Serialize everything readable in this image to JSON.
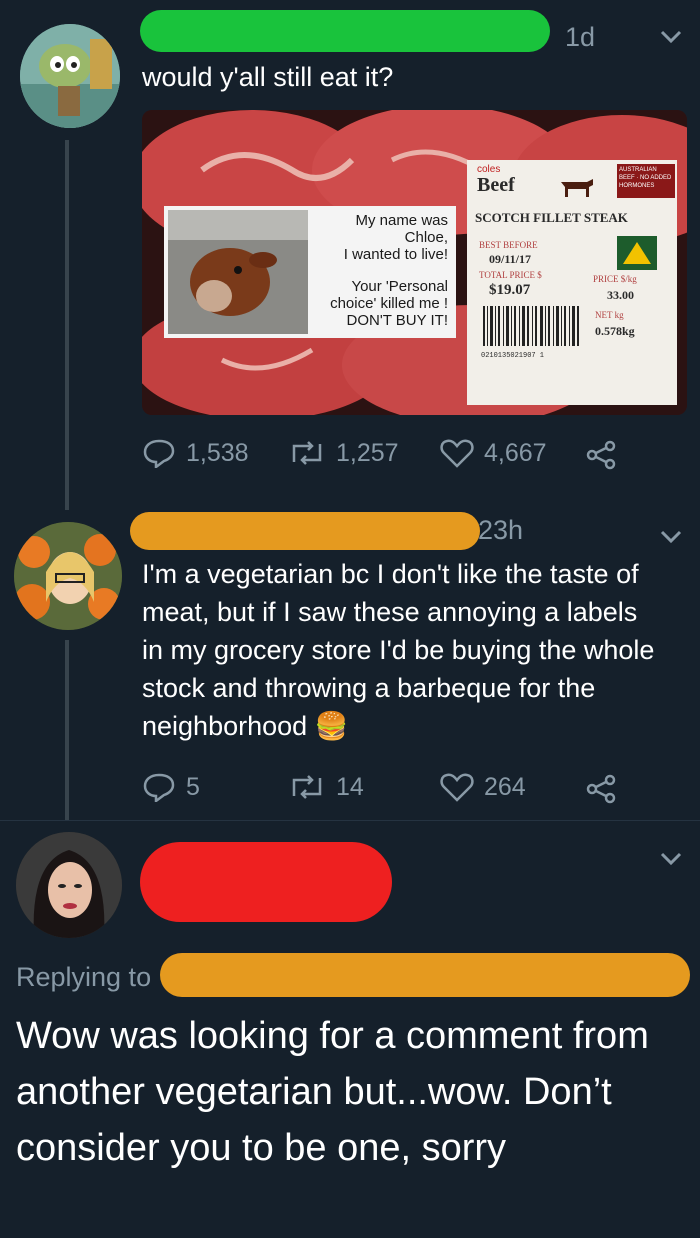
{
  "tweets": [
    {
      "time": "1d",
      "text": "would y'all still eat it?",
      "photo": {
        "sticker_top": "My name was\nChloe,\nI wanted to live!",
        "sticker_bottom": "Your 'Personal\nchoice' killed me !\nDON'T BUY IT!",
        "brand": "coles",
        "product_word": "Beef",
        "badge": "AUSTRALIAN BEEF · NO ADDED HORMONES",
        "product_name": "SCOTCH FILLET STEAK",
        "best_before_label": "BEST BEFORE",
        "best_before": "09/11/17",
        "total_price_label": "TOTAL PRICE $",
        "total_price": "$19.07",
        "price_kg_label": "PRICE $/kg",
        "price_kg": "33.00",
        "net_label": "NET kg",
        "net": "0.578kg",
        "barcode_digits": "0210135021907 1"
      },
      "replies": "1,538",
      "retweets": "1,257",
      "likes": "4,667"
    },
    {
      "time": "23h",
      "text": "I'm a vegetarian bc I don't like the taste of meat, but if I saw these annoying a labels in my grocery store I'd be buying the whole stock and throwing a barbeque for the neighborhood",
      "emoji": "🍔",
      "replies": "5",
      "retweets": "14",
      "likes": "264"
    },
    {
      "replying_label": "Replying to",
      "text": "Wow was looking for a comment from another vegetarian but...wow. Don’t consider you to be one, sorry"
    }
  ],
  "colors": {
    "background": "#15202b",
    "muted": "#8899a6",
    "thread_line": "#38444d",
    "redact_green": "#19c33c",
    "redact_orange": "#e59a1f",
    "redact_red": "#ee2020"
  }
}
